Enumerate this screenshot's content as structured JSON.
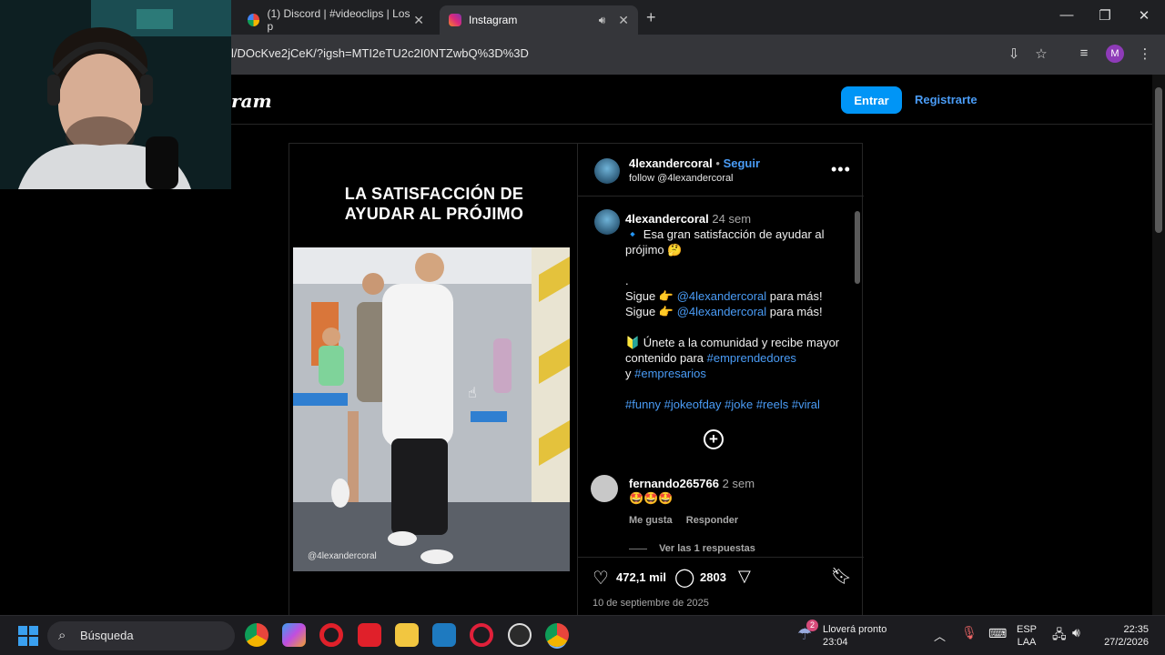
{
  "browser": {
    "tabs": [
      {
        "label": "(1) Discord | #videoclips | Los p",
        "active": false
      },
      {
        "label": "Instagram",
        "active": true
      }
    ],
    "url": "l/DOcKve2jCeK/?igsh=MTI2eTU2c2I0NTZwbQ%3D%3D",
    "profile_initial": "M"
  },
  "header": {
    "logo_text": "ram",
    "login_label": "Entrar",
    "signup_label": "Registrarte"
  },
  "post": {
    "media_caption": "LA SATISFACCIÓN DE AYUDAR AL PRÓJIMO",
    "watermark": "@4lexandercoral",
    "author": "4lexandercoral",
    "follow_sep": "•",
    "follow_label": "Seguir",
    "audio_line": "follow @4lexandercoral",
    "caption_author": "4lexandercoral",
    "caption_time": "24 sem",
    "caption": {
      "line1": "🔹 Esa gran satisfacción de ayudar al prójimo 🤔",
      "dot": ".",
      "sigue": "Sigue 👉",
      "mention": "@4lexandercoral",
      "para": "para más!",
      "unete": "🔰 Únete a la comunidad y recibe mayor contenido para",
      "tag_emp": "#emprendedores",
      "y": "y",
      "tag_empr": "#empresarios",
      "tags": "#funny #jokeofday #joke #reels #viral"
    },
    "comment": {
      "user": "fernando265766",
      "time": "2 sem",
      "text": "🤩🤩🤩",
      "like_label": "Me gusta",
      "reply_label": "Responder",
      "view_replies": "Ver las 1 respuestas"
    },
    "likes": "472,1 mil",
    "comments_count": "2803",
    "date": "10 de septiembre de 2025"
  },
  "taskbar": {
    "search_label": "Búsqueda",
    "weather_title": "Lloverá pronto",
    "weather_time": "23:04",
    "weather_badge": "2",
    "lang": "ESP",
    "lang_sub": "LAA",
    "time": "22:35",
    "date": "27/2/2026"
  },
  "colors": {
    "accent": "#0095f6",
    "link": "#4a9cf6"
  }
}
